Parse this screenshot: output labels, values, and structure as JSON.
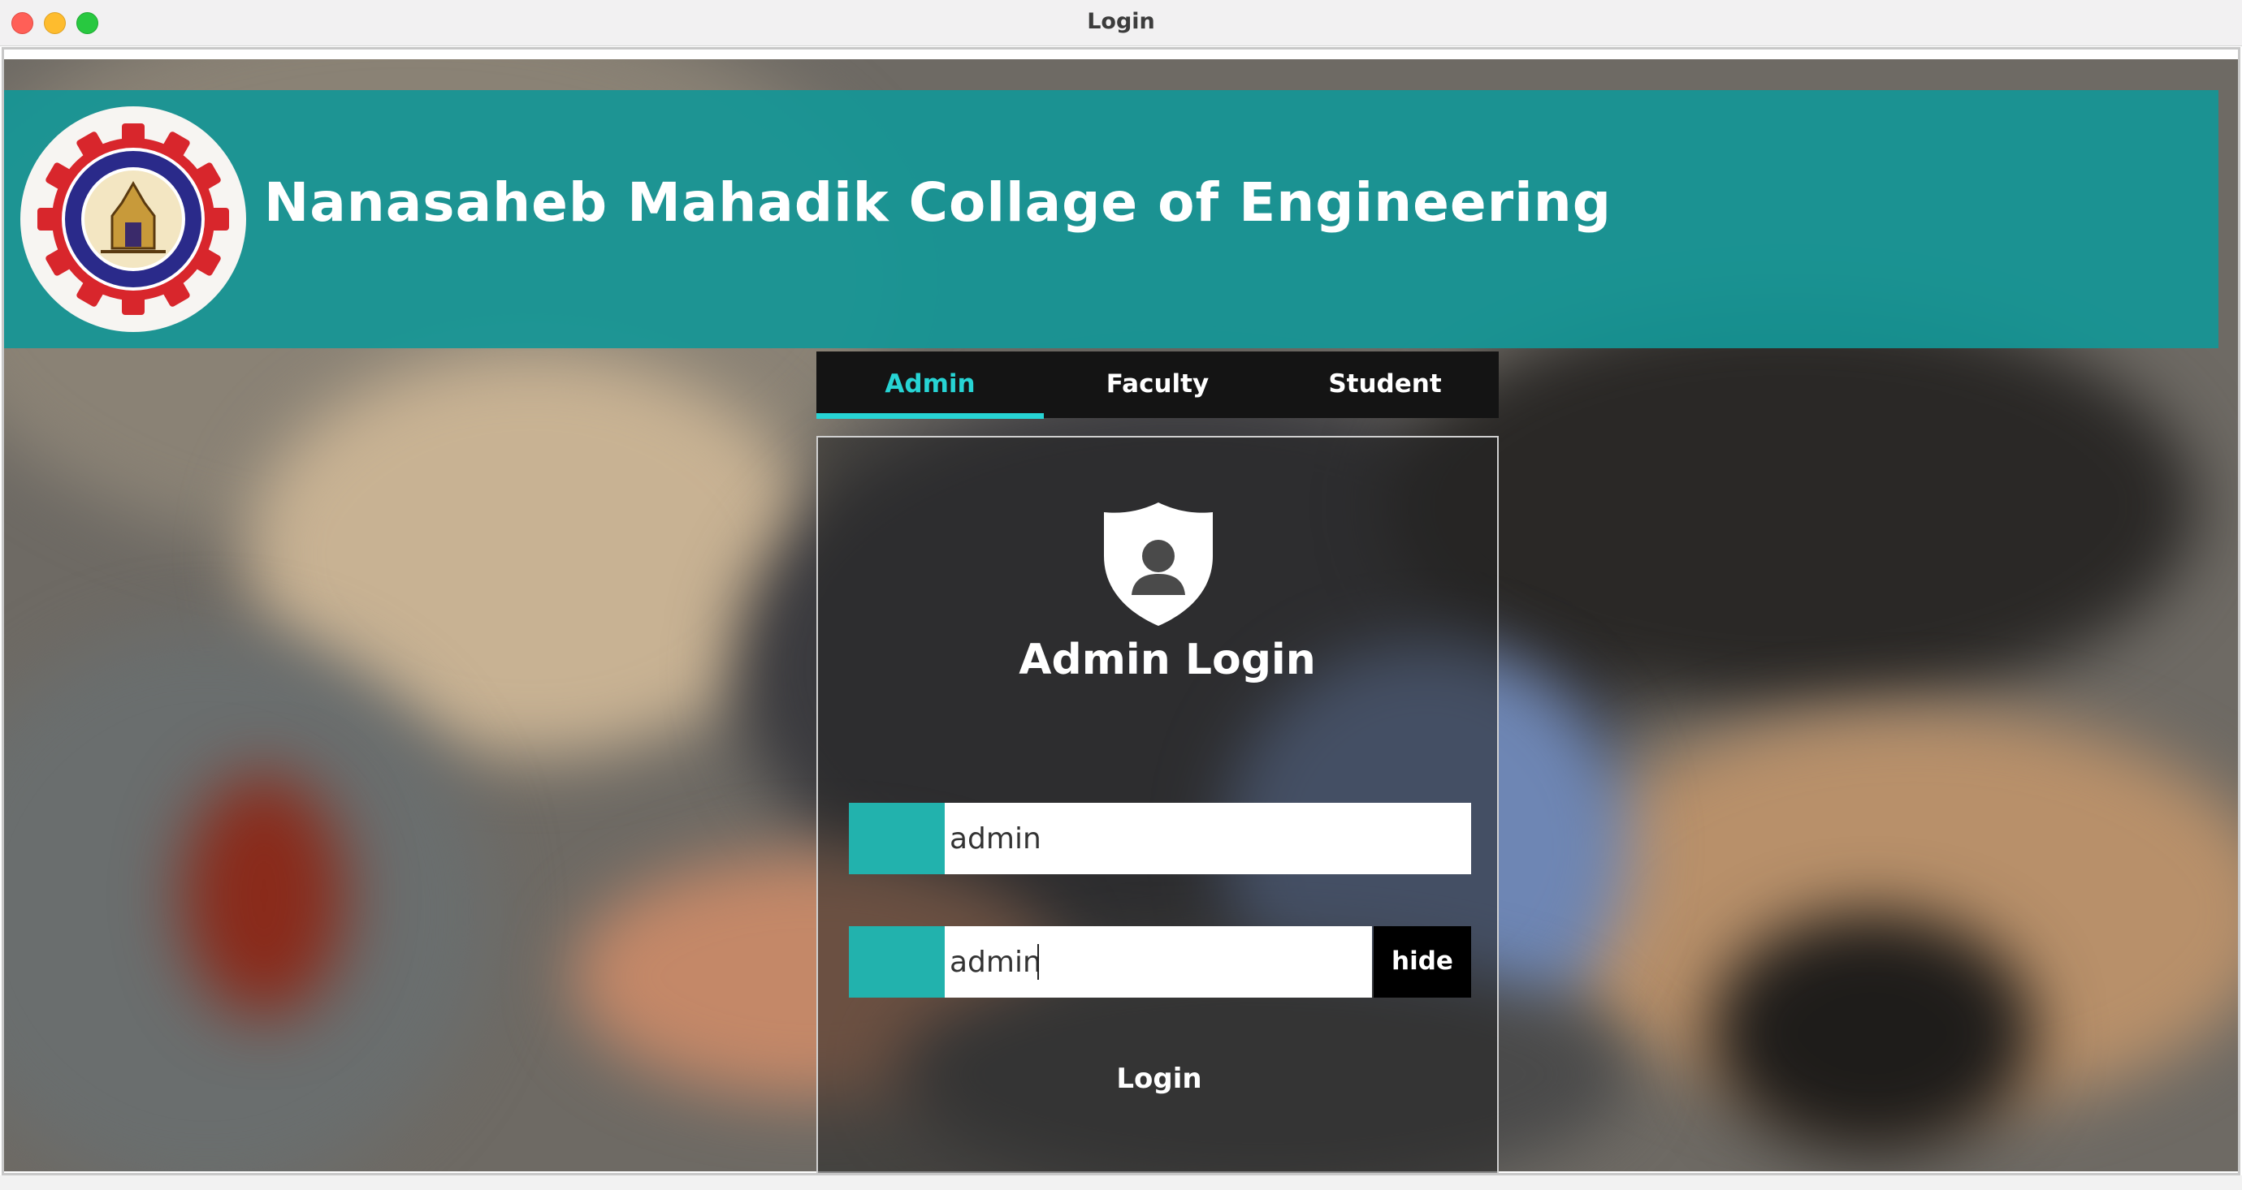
{
  "window": {
    "title": "Login"
  },
  "header": {
    "college_name": "Nanasaheb Mahadik Collage of Engineering",
    "logo_icon": "college-seal-icon",
    "band_color": "#179a9a"
  },
  "tabs": [
    {
      "label": "Admin",
      "active": true
    },
    {
      "label": "Faculty",
      "active": false
    },
    {
      "label": "Student",
      "active": false
    }
  ],
  "login_panel": {
    "icon": "shield-user-icon",
    "title": "Admin Login",
    "username_value": "admin",
    "password_value": "admin",
    "toggle_label": "hide",
    "submit_label": "Login",
    "accent_color": "#22b2ad",
    "active_tab_color": "#27d4d4"
  }
}
